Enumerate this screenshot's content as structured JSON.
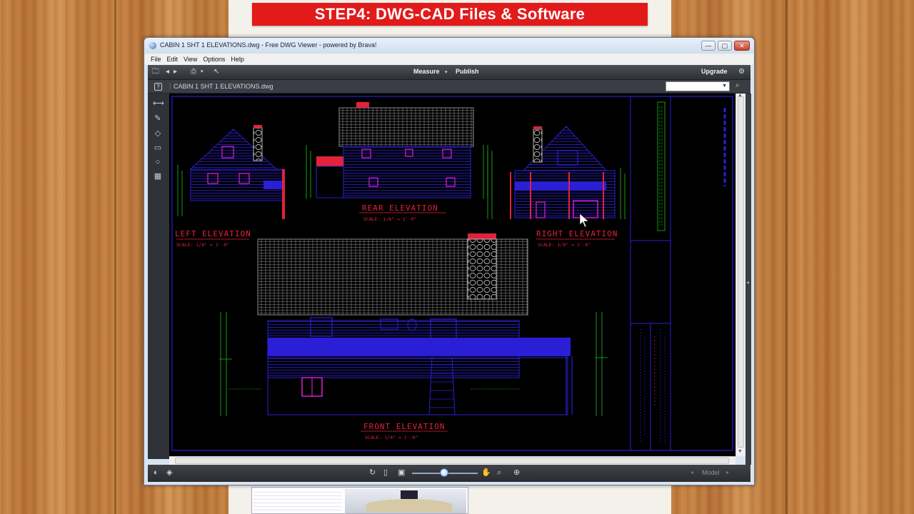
{
  "banner": {
    "title": "STEP4: DWG-CAD Files & Software"
  },
  "window": {
    "title": "CABIN 1 SHT 1 ELEVATIONS.dwg - Free DWG Viewer - powered by Brava!",
    "min_label": "—",
    "max_label": "▢",
    "close_label": "✕"
  },
  "menubar": {
    "items": [
      "File",
      "Edit",
      "View",
      "Options",
      "Help"
    ]
  },
  "toolbar": {
    "measure_label": "Measure",
    "measure_arrow": "▾",
    "publish_label": "Publish",
    "upgrade_label": "Upgrade"
  },
  "docbar": {
    "help_label": "?",
    "document_name": "CABIN 1 SHT 1 ELEVATIONS.dwg"
  },
  "drawing": {
    "labels": {
      "rear": "REAR ELEVATION",
      "rear_scale": "SCALE: 1/8\" = 1'-0\"",
      "left": "LEFT ELEVATION",
      "left_scale": "SCALE: 1/8\" = 1'-0\"",
      "right": "RIGHT ELEVATION",
      "right_scale": "SCALE: 1/8\" = 1'-0\"",
      "front": "FRONT ELEVATION",
      "front_scale": "SCALE: 1/4\" = 1'-0\""
    },
    "colors": {
      "background": "#000000",
      "lines": "#2b1fd6",
      "labels": "#e0233a",
      "dimensions": "#18c21c",
      "windows": "#d21cc8",
      "roof": "#9a9a9a"
    }
  },
  "statusbar": {
    "model_label": "Model"
  }
}
